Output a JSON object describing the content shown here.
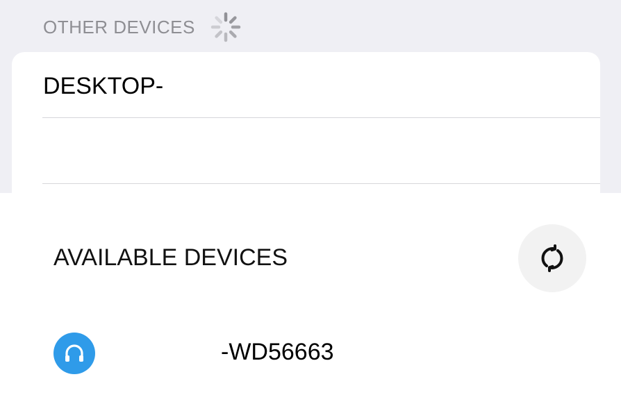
{
  "other_devices": {
    "header": "OTHER DEVICES",
    "spinner_icon": "loading-spinner-icon",
    "items": [
      {
        "name": "DESKTOP-"
      },
      {
        "name": ""
      }
    ]
  },
  "available_devices": {
    "title": "AVAILABLE DEVICES",
    "refresh_icon": "refresh-icon",
    "items": [
      {
        "name": "-WD56663",
        "icon": "headphones-icon",
        "icon_color": "#2f9be9"
      }
    ]
  },
  "colors": {
    "background_gray": "#efeff4",
    "header_text": "#8e8e93",
    "accent_blue": "#2f9be9"
  }
}
